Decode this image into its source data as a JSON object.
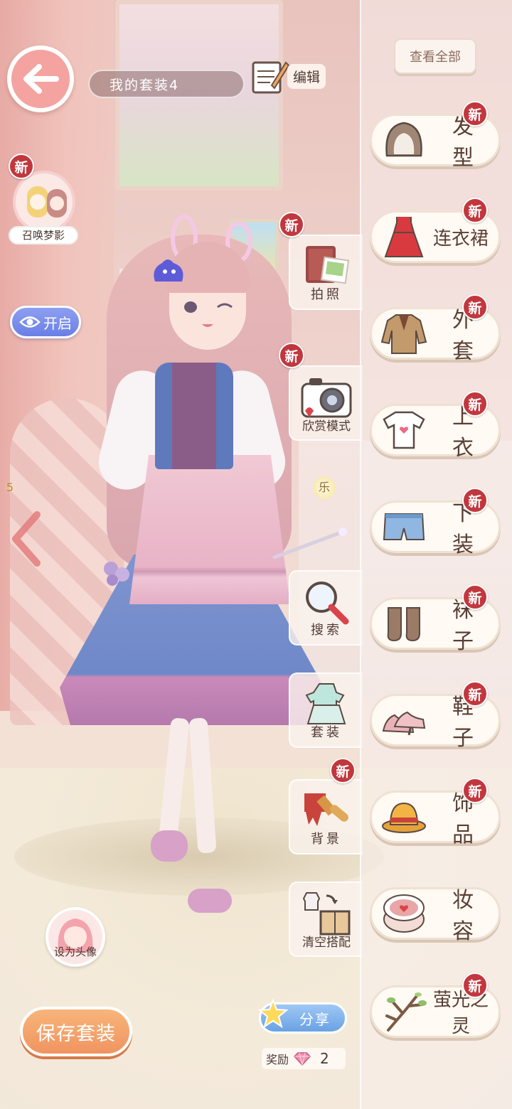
{
  "top_bar": {
    "outfit_name": "我的套装4",
    "edit_label": "编辑"
  },
  "left_panel": {
    "summon_label": "召唤梦影",
    "summon_badge": "新",
    "toggle_label": "开启",
    "set_avatar_label": "设为头像",
    "save_label": "保存套装"
  },
  "tools": [
    {
      "label": "拍照",
      "badge": "新"
    },
    {
      "label": "欣赏模式",
      "badge": "新"
    },
    {
      "label": "搜索",
      "badge": ""
    },
    {
      "label": "套装",
      "badge": ""
    },
    {
      "label": "背景",
      "badge": "新"
    },
    {
      "label": "清空搭配",
      "badge": ""
    }
  ],
  "menu": {
    "view_all_label": "查看全部",
    "categories": [
      {
        "label": "发型",
        "badge": "新",
        "icon": "hairstyle-icon"
      },
      {
        "label": "连衣裙",
        "badge": "新",
        "icon": "dress-icon"
      },
      {
        "label": "外套",
        "badge": "新",
        "icon": "coat-icon"
      },
      {
        "label": "上衣",
        "badge": "新",
        "icon": "shirt-icon"
      },
      {
        "label": "下装",
        "badge": "新",
        "icon": "shorts-icon"
      },
      {
        "label": "袜子",
        "badge": "新",
        "icon": "socks-icon"
      },
      {
        "label": "鞋子",
        "badge": "新",
        "icon": "shoes-icon"
      },
      {
        "label": "饰品",
        "badge": "新",
        "icon": "hat-icon"
      },
      {
        "label": "妆容",
        "badge": "",
        "icon": "makeup-compact-icon"
      },
      {
        "label": "萤光之灵",
        "badge": "新",
        "icon": "branch-icon"
      }
    ]
  },
  "bottom": {
    "share_label": "分享",
    "reward_label": "奖励",
    "reward_count": "2"
  },
  "scene_text": {
    "star_left": "5",
    "star_right": "乐"
  },
  "colors": {
    "badge_red": "#c2373e",
    "back_button": "#f4a3a0",
    "save_button": "#f09460",
    "share_button": "#6aa2e4",
    "toggle_button": "#6a7fe5"
  }
}
